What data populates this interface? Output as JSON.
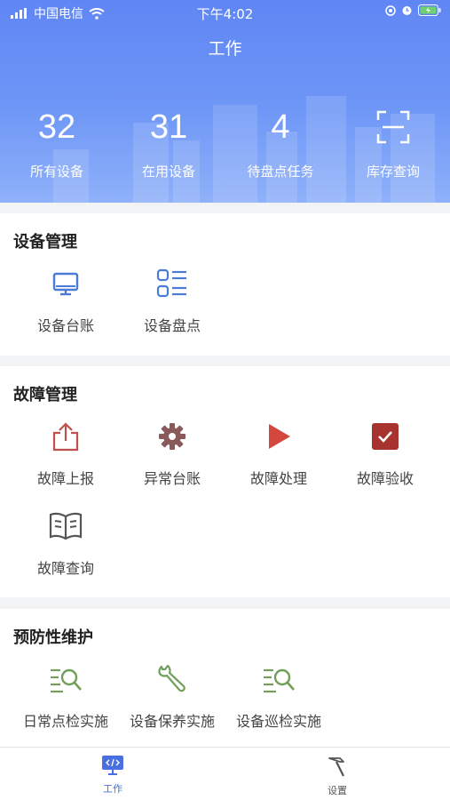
{
  "status_bar": {
    "carrier": "中国电信",
    "time": "下午4:02"
  },
  "header": {
    "title": "工作",
    "stats": [
      {
        "value": "32",
        "label": "所有设备"
      },
      {
        "value": "31",
        "label": "在用设备"
      },
      {
        "value": "4",
        "label": "待盘点任务"
      },
      {
        "label": "库存查询",
        "icon": "scan-icon"
      }
    ]
  },
  "sections": {
    "equipment": {
      "title": "设备管理",
      "items": [
        {
          "label": "设备台账",
          "icon": "monitor-icon"
        },
        {
          "label": "设备盘点",
          "icon": "list-icon"
        }
      ]
    },
    "fault": {
      "title": "故障管理",
      "items": [
        {
          "label": "故障上报",
          "icon": "upload-icon"
        },
        {
          "label": "异常台账",
          "icon": "gear-icon"
        },
        {
          "label": "故障处理",
          "icon": "play-icon"
        },
        {
          "label": "故障验收",
          "icon": "checkbox-icon"
        },
        {
          "label": "故障查询",
          "icon": "book-icon"
        }
      ]
    },
    "maintenance": {
      "title": "预防性维护",
      "items": [
        {
          "label": "日常点检实施",
          "icon": "search-list-icon"
        },
        {
          "label": "设备保养实施",
          "icon": "wrench-icon"
        },
        {
          "label": "设备巡检实施",
          "icon": "search-list-icon"
        }
      ]
    }
  },
  "tabbar": {
    "tabs": [
      {
        "label": "工作",
        "icon": "code-monitor-icon",
        "active": true
      },
      {
        "label": "设置",
        "icon": "hammer-icon",
        "active": false
      }
    ]
  },
  "colors": {
    "header_blue": "#6b91f5",
    "icon_blue": "#4a7bd6",
    "icon_red": "#c0504d",
    "icon_green": "#6f9f5b",
    "tab_active": "#4a6fe0",
    "tab_inactive": "#555555"
  }
}
